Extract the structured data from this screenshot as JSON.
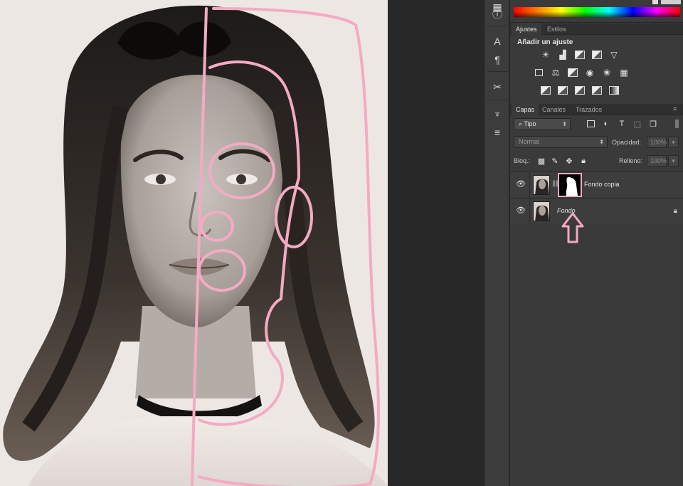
{
  "adjustments": {
    "tabs": [
      "Ajustes",
      "Estilos"
    ],
    "title": "Añadir un ajuste"
  },
  "layers": {
    "tabs": [
      "Capas",
      "Canales",
      "Trazados"
    ],
    "filter_kind": "Tipo",
    "blend_mode": "Normal",
    "opacity_label": "Opacidad:",
    "opacity_value": "100%",
    "lock_label": "Bloq.:",
    "fill_label": "Relleno:",
    "fill_value": "100%",
    "items": [
      {
        "name": "Fondo copia",
        "has_mask": true,
        "visible": true
      },
      {
        "name": "Fondo",
        "has_mask": false,
        "visible": true,
        "locked": true
      }
    ]
  },
  "colors": {
    "annotation": "#f4aac4",
    "panel_bg": "#3a3a3a"
  }
}
